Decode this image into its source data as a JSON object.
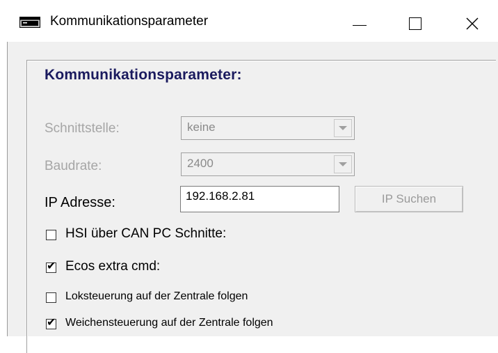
{
  "window": {
    "title": "Kommunikationsparameter",
    "icon": "terminal-window-icon",
    "close_glyph": "✕"
  },
  "group": {
    "heading": "Kommunikationsparameter:"
  },
  "form": {
    "schnittstelle_label": "Schnittstelle:",
    "schnittstelle_value": "keine",
    "baudrate_label": "Baudrate:",
    "baudrate_value": "2400",
    "ip_label": "IP Adresse:",
    "ip_value": "192.168.2.81",
    "ip_search_label": "IP Suchen"
  },
  "checkboxes": {
    "hsi": {
      "label": "HSI über CAN PC Schnitte:",
      "checked": false
    },
    "ecos": {
      "label": "Ecos extra cmd:",
      "checked": true
    },
    "loksteuerung": {
      "label": "Loksteuerung auf der Zentrale folgen",
      "checked": false
    },
    "weichensteuerung": {
      "label": "Weichensteuerung auf der Zentrale folgen",
      "checked": true
    }
  },
  "check_glyph": "✔",
  "colors": {
    "heading": "#1a1a5e",
    "disabled_text": "#a6a6a6",
    "dialog_bg": "#f0f0f0"
  }
}
